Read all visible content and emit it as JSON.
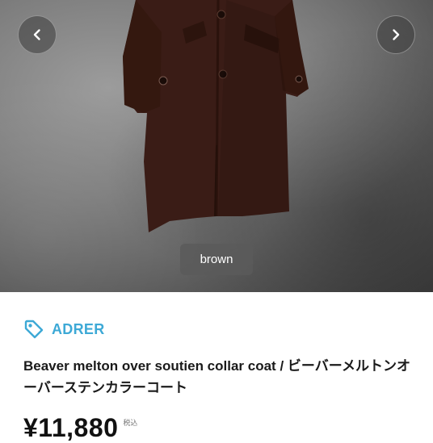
{
  "gallery": {
    "color_label": "brown",
    "prev_icon": "chevron-left-icon",
    "next_icon": "chevron-right-icon"
  },
  "product": {
    "brand": "ADRER",
    "brand_icon": "tag-icon",
    "title": "Beaver melton over soutien collar coat / ビーバーメルトンオーバーステンカラーコート",
    "price": "¥11,880",
    "tax_note": "税込"
  },
  "colors": {
    "accent": "#3da9d6",
    "coat": "#3a1c16"
  }
}
